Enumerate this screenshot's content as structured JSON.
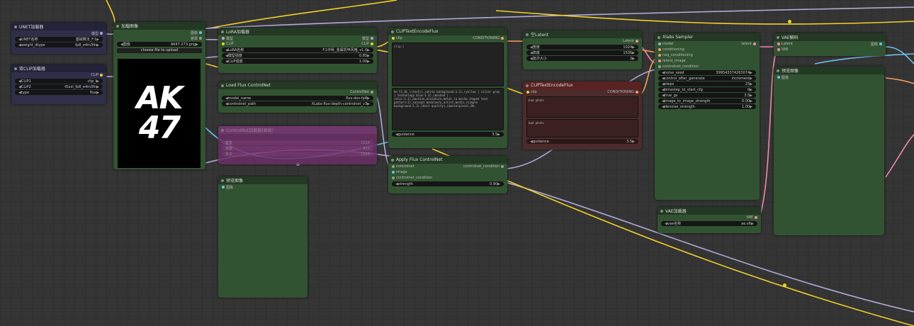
{
  "colors": {
    "canvas": "#353535",
    "wire_yellow": "#f0d02a",
    "wire_lavender": "#b0a9d6",
    "wire_pink": "#f18aa6",
    "wire_orange": "#f4a05a",
    "wire_blue": "#6ec0e8"
  },
  "nodes": {
    "unet": {
      "title": "UNET加载器",
      "output": "模型",
      "unet_name_label": "UNET名称",
      "unet_name_value": "基础算法_F.1",
      "weight_dtype_label": "weight_dtype",
      "weight_dtype_value": "fp8_e4m3fn"
    },
    "dualclip": {
      "title": "双CLIP加载器",
      "output": "CLIP",
      "clip1_label": "CLIP1",
      "clip1_value": "clip_l",
      "clip2_label": "CLIP2",
      "clip2_value": "t5xxl_fp8_e4m3fn",
      "type_label": "type",
      "type_value": "flux"
    },
    "loadimage": {
      "title": "加载图像",
      "out_image": "图像",
      "out_mask": "遮罩",
      "image_label": "图像",
      "image_value": "AK47.273.png",
      "upload": "choose file to upload",
      "preview_line1": "AK",
      "preview_line2": "47"
    },
    "lora": {
      "title": "LoRA加载器",
      "in_model": "模型",
      "in_clip": "CLIP",
      "out_model": "模型",
      "out_clip": "CLIP",
      "lora_label": "LoRA名称",
      "lora_value": "F.1中秋_金属机甲风格_v1.0",
      "strength_model_label": "模型强度",
      "strength_model_value": "0.85",
      "strength_clip_label": "CLIP强度",
      "strength_clip_value": "1.00"
    },
    "controlnet": {
      "title": "Load Flux ControlNet",
      "output": "ControlNet",
      "model_label": "model_name",
      "model_value": "flux-dev-fp8",
      "path_label": "controlnet_path",
      "path_value": "XLabs-flux-depth-controlnet_v3"
    },
    "clip_pos": {
      "title": "CLIPTextEncodeFlux",
      "in_clip": "clip",
      "out": "CONDITIONING",
      "text1": "clip_l",
      "text2": "An F1_OL_\\(text\\),(white background:1.3),(yellow | silver gray | technology blue:1.3),(mecha4 | color:1.1),machine,miniature,metal,(a mecha-shaped text pattern:1),concept machinery,artist,mecha,(simple background:1.3),(best quality),(masterpiece),8k,",
      "guidance_label": "guidance",
      "guidance_value": "3.5"
    },
    "latent": {
      "title": "空Latent",
      "out": "Latent",
      "width_label": "宽度",
      "width_value": "1024",
      "height_label": "高度",
      "height_value": "1536",
      "batch_label": "批次大小",
      "batch_value": "2"
    },
    "clip_neg": {
      "title": "CLIPTextEncodeFlux",
      "in_clip": "clip",
      "out": "CONDITIONING",
      "text1": "bad photo",
      "text2": "bad photo",
      "guidance_label": "guidance",
      "guidance_value": "3.5"
    },
    "sampler": {
      "title": "Xlabs Sampler",
      "out": "latent",
      "inputs": [
        "model",
        "conditioning",
        "neg_conditioning",
        "latent_image",
        "controlnet_condition"
      ],
      "widgets": [
        {
          "label": "noise_seed",
          "value": "399543374263074"
        },
        {
          "label": "control_after_generate",
          "value": "increment"
        },
        {
          "label": "steps",
          "value": "25"
        },
        {
          "label": "timestep_to_start_cfg",
          "value": "0"
        },
        {
          "label": "true_gs",
          "value": "3.5"
        },
        {
          "label": "image_to_image_strength",
          "value": "0.00"
        },
        {
          "label": "denoise_strength",
          "value": "1.00"
        }
      ]
    },
    "apply_cn": {
      "title": "Apply Flux ControlNet",
      "in1": "controlnet",
      "in2": "image",
      "in3": "controlnet_condition",
      "out": "controlnet_condition",
      "strength_label": "strength",
      "strength_value": "0.90"
    },
    "preview1": {
      "title": "预览图像",
      "input": "图像"
    },
    "vaedecode": {
      "title": "VAE解码",
      "in_latent": "Latent",
      "in_vae": "VAE",
      "out": "图像"
    },
    "preview2": {
      "title": "预览图像",
      "input": "图像"
    },
    "vaeloader": {
      "title": "VAE加载器",
      "out": "VAE",
      "name_label": "vae名称",
      "name_value": "ae.sft"
    },
    "muted": {
      "title": "ControlNet加载器(高级)",
      "rows": [
        {
          "label": "宽度",
          "value": "1024"
        },
        {
          "label": "高度",
          "value": "512"
        },
        {
          "label": "批次",
          "value": "1024"
        }
      ]
    }
  }
}
